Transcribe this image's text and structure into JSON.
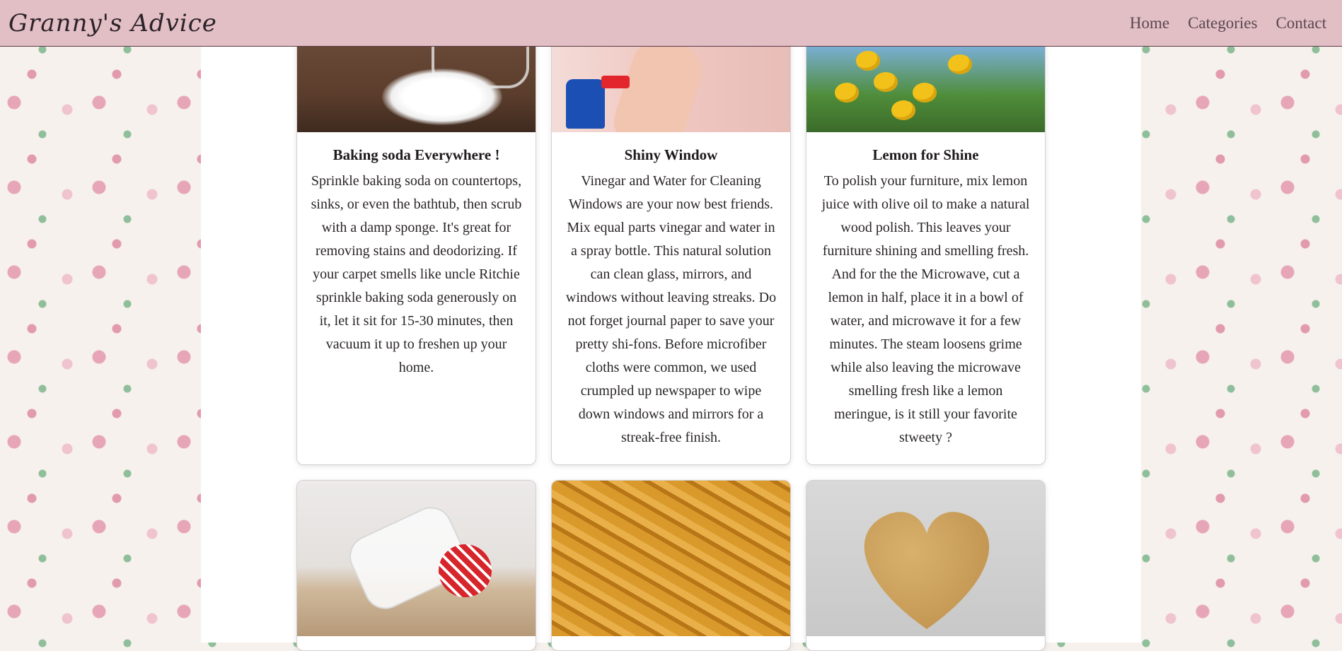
{
  "header": {
    "brand": "Granny's Advice",
    "nav": [
      "Home",
      "Categories",
      "Contact"
    ]
  },
  "cards": [
    {
      "title": "Baking soda Everywhere !",
      "text": "Sprinkle baking soda on countertops, sinks, or even the bathtub, then scrub with a damp sponge. It's great for removing stains and deodorizing. If your carpet smells like uncle Ritchie sprinkle baking soda generously on it, let it sit for 15-30 minutes, then vacuum it up to freshen up your home.",
      "image": "baking-soda-photo"
    },
    {
      "title": "Shiny Window",
      "text": "Vinegar and Water for Cleaning Windows are your now best friends. Mix equal parts vinegar and water in a spray bottle. This natural solution can clean glass, mirrors, and windows without leaving streaks. Do not forget journal paper to save your pretty shi-fons. Before microfiber cloths were common, we used crumpled up newspaper to wipe down windows and mirrors for a streak-free finish.",
      "image": "window-spray-photo"
    },
    {
      "title": "Lemon for Shine",
      "text": "To polish your furniture, mix lemon juice with olive oil to make a natural wood polish. This leaves your furniture shining and smelling fresh. And for the the Microwave, cut a lemon in half, place it in a bowl of water, and microwave it for a few minutes. The steam loosens grime while also leaving the microwave smelling fresh like a lemon meringue, is it still your favorite stweety ?",
      "image": "lemon-tree-photo"
    }
  ],
  "bottom_images": [
    "salt-shaker-photo",
    "corn-cobs-photo",
    "heart-potato-photo"
  ]
}
